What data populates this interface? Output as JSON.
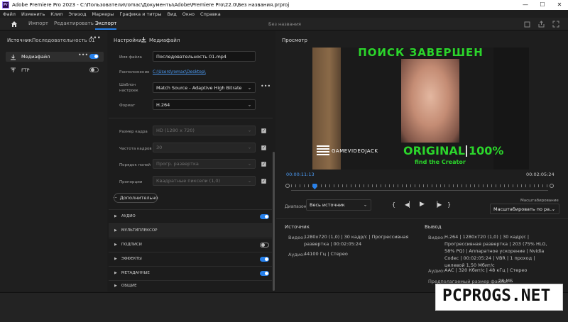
{
  "window": {
    "app_icon": "Pr",
    "title": "Adobe Premiere Pro 2023 - C:\\Пользователи\\romac\\Документы\\Adobe\\Premiere Pro\\22.0\\Без названия.prproj"
  },
  "menu": [
    "Файл",
    "Изменить",
    "Клип",
    "Эпизод",
    "Маркеры",
    "Графика и титры",
    "Вид",
    "Окно",
    "Справка"
  ],
  "workspace": {
    "tabs": [
      "Импорт",
      "Редактировать",
      "Экспорт"
    ],
    "active_tab": "Экспорт",
    "center_title": "Без названия"
  },
  "source_panel": {
    "label": "Источник:",
    "sequence": "Последовательность 01",
    "destinations": [
      {
        "label": "Медиафайл",
        "enabled": true,
        "selected": true
      },
      {
        "label": "FTP",
        "enabled": false,
        "selected": false
      }
    ]
  },
  "settings": {
    "label": "Настройки:",
    "target": "Медиафайл",
    "file_name_label": "Имя файла",
    "file_name": "Последовательность 01.mp4",
    "location_label": "Расположение",
    "location": "C:\\Users\\romac\\Desktop\\",
    "preset_label": "Шаблон настроек",
    "preset": "Match Source - Adaptive High Bitrate",
    "format_label": "Формат",
    "format": "H.264",
    "frame_size_label": "Размер кадра",
    "frame_size": "HD (1280 x 720)",
    "frame_rate_label": "Частота кадров",
    "frame_rate": "30",
    "field_order_label": "Порядок полей",
    "field_order": "Прогр. развертка",
    "aspect_label": "Пропорции",
    "aspect": "Квадратные пиксели (1,0)",
    "more_button": "Дополнительно",
    "sections": [
      {
        "label": "АУДИО",
        "toggle": "on"
      },
      {
        "label": "МУЛЬТИПЛЕКСОР",
        "toggle": "none"
      },
      {
        "label": "ПОДПИСИ",
        "toggle": "off"
      },
      {
        "label": "ЭФФЕКТЫ",
        "toggle": "on"
      },
      {
        "label": "МЕТАДАННЫЕ",
        "toggle": "on"
      },
      {
        "label": "ОБЩИЕ",
        "toggle": "none"
      }
    ]
  },
  "preview": {
    "title": "Просмотр",
    "video_text": {
      "top_banner": "ПОИСК ЗАВЕРШЕН",
      "logo": "GAMEVIDEOJACK",
      "original": "ORIGINAL",
      "percent": "100%",
      "subtitle": "find the Creator"
    },
    "timecode_current": "00:00:11:13",
    "timecode_duration": "00:02:05:24",
    "playhead_fraction": 0.092,
    "range_label": "Диапазон",
    "range": "Весь источник",
    "scale_label": "Масштабирование",
    "scale": "Масштабировать по ра..."
  },
  "summary": {
    "source_title": "Источник",
    "output_title": "Вывод",
    "video_label": "Видео:",
    "audio_label": "Аудио:",
    "source_video": "1280x720 (1,0)  |  30 кадр/с  |  Прогрессивная развертка  |  00:02:05:24",
    "source_audio": "44100 Гц  |  Стерео",
    "output_video": "H.264  |  1280x720 (1,0)  |  30 кадр/с  |  Прогрессивная развертка  |  203 (75% HLG, 58% PQ)  |  Аппаратное ускорение  |  Nvidia Codec  |  00:02:05:24  |  VBR  |  1 проход  |  целевой 1,50 Мбит/с",
    "output_audio": "AAC  |  320 Кбит/с  |  48 кГц  |  Стерео",
    "filesize_label": "Предполагаемый размер файла:",
    "filesize": "28 МБ"
  },
  "watermark": "PCPROGS.NET",
  "colors": {
    "accent": "#2680eb",
    "overlay_green": "#2bd52b"
  }
}
